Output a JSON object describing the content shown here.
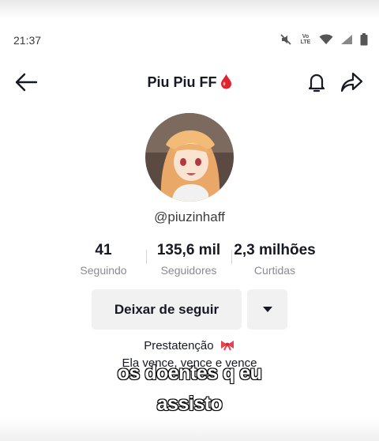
{
  "status_bar": {
    "time": "21:37",
    "icons": [
      "mute-icon",
      "volte-icon",
      "wifi-icon",
      "signal-icon",
      "battery-icon"
    ],
    "volte_text": "Vo LTE"
  },
  "header": {
    "title": "Piu Piu FF",
    "title_emoji": "drop-of-blood-icon",
    "icons": [
      "back-arrow-icon",
      "bell-icon",
      "share-icon"
    ]
  },
  "profile": {
    "username": "@piuzinhaff",
    "stats": [
      {
        "value": "41",
        "label": "Seguindo"
      },
      {
        "value": "135,6 mil",
        "label": "Seguidores"
      },
      {
        "value": "2,3 milhões",
        "label": "Curtidas"
      }
    ],
    "follow_button": "Deixar de seguir",
    "more_icon": "caret-down-icon",
    "bio_line1": "Prestatenção",
    "bio_line1_emoji": "ribbon-icon",
    "bio_line2": "Ela vence, vence e vence"
  },
  "overlay_caption": {
    "line1": "os doentes q eu",
    "line2": "assisto"
  },
  "colors": {
    "text_primary": "#161823",
    "text_secondary": "#8a8b91",
    "button_bg": "#f1f1f2",
    "blood_red": "#e0242f"
  }
}
